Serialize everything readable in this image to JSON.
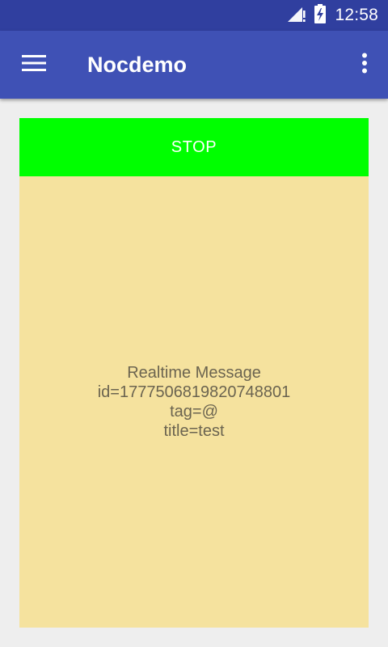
{
  "status_bar": {
    "time": "12:58",
    "icons": [
      "signal-no-data-icon",
      "battery-charging-icon"
    ],
    "background": "#303f9f"
  },
  "app_bar": {
    "title": "Nocdemo",
    "icons": [
      "hamburger-menu-icon",
      "overflow-menu-icon"
    ],
    "background": "#3f51b5"
  },
  "main": {
    "stop_button": {
      "label": "STOP",
      "background": "#00ff00"
    },
    "message_panel": {
      "background": "#f5e29e",
      "lines": [
        "Realtime Message",
        "id=1777506819820748801",
        "tag=@",
        "title=test"
      ]
    }
  }
}
